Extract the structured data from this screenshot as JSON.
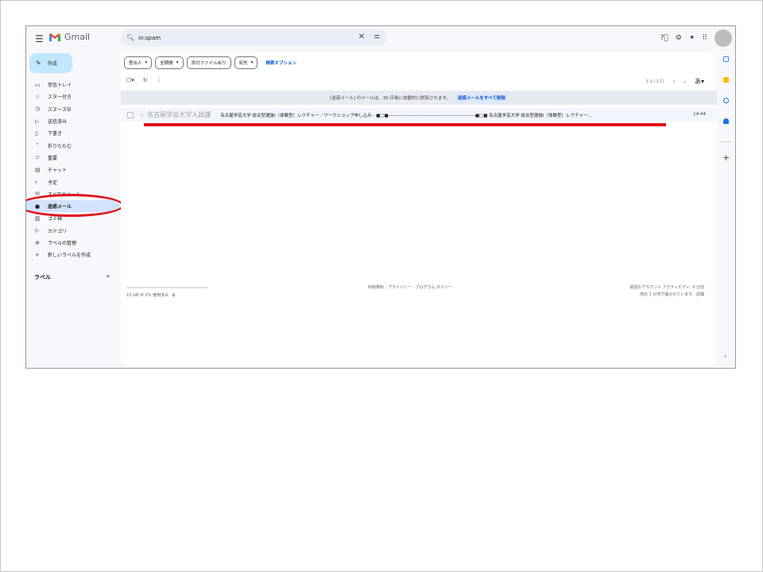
{
  "app": {
    "title": "Gmail"
  },
  "search": {
    "query": "in:spam"
  },
  "compose": {
    "label": "作成"
  },
  "nav": {
    "items": [
      {
        "icon": "inbox-icon",
        "glyph": "▭",
        "label": "受信トレイ"
      },
      {
        "icon": "star-icon",
        "glyph": "☆",
        "label": "スター付き"
      },
      {
        "icon": "clock-icon",
        "glyph": "◷",
        "label": "スヌーズ中"
      },
      {
        "icon": "send-icon",
        "glyph": "▷",
        "label": "送信済み"
      },
      {
        "icon": "draft-icon",
        "glyph": "▯",
        "label": "下書き"
      },
      {
        "icon": "collapse-icon",
        "glyph": "⌃",
        "label": "折りたたむ"
      },
      {
        "icon": "important-icon",
        "glyph": "⊃",
        "label": "重要"
      },
      {
        "icon": "chat-icon",
        "glyph": "▤",
        "label": "チャット"
      },
      {
        "icon": "scheduled-icon",
        "glyph": "▹",
        "label": "予定"
      },
      {
        "icon": "all-mail-icon",
        "glyph": "✉",
        "label": "すべてのメール"
      },
      {
        "icon": "spam-icon",
        "glyph": "●",
        "label": "迷惑メール"
      },
      {
        "icon": "trash-icon",
        "glyph": "▥",
        "label": "ゴミ箱"
      },
      {
        "icon": "category-icon",
        "glyph": "▷",
        "label": "カテゴリ"
      },
      {
        "icon": "manage-labels-icon",
        "glyph": "✲",
        "label": "ラベルの管理"
      },
      {
        "icon": "plus-icon",
        "glyph": "+",
        "label": "新しいラベルを作成"
      }
    ],
    "labels_heading": "ラベル",
    "labels_add": "+"
  },
  "filters": {
    "chips": [
      "差出人",
      "全期間",
      "添付ファイルあり",
      "宛先"
    ],
    "advanced": "検索オプション"
  },
  "pager": {
    "range": "1-1 / 1 行",
    "sort": "あ"
  },
  "banner": {
    "text": "[迷惑メール] のメールは、30 日後に自動的に削除されます。",
    "action": "迷惑メールをすべて削除"
  },
  "messages": [
    {
      "sender": "名古屋学芸大学入試課",
      "subject": "名古屋学芸大学 総合型選抜Ⅰ（体験型）レクチャー／ワークショップ申し込み - ■□■-------------------------------------------------------■□■ 名古屋学芸大学 総合型選抜Ⅰ（体験型）レクチャー...",
      "time": "14:44"
    }
  ],
  "footer": {
    "storage": "15 GB 中 0% 使用済み",
    "links": "利用規約 · プライバシー · プログラム ポリシー",
    "activity_1": "前回のアカウント アクティビティ: 0 分前",
    "activity_2": "他の 1 か所で開かれています · 詳細"
  },
  "colors": {
    "annotation": "#e0141d",
    "compose": "#c2e7ff",
    "active": "#d3e3fd",
    "link": "#0b57d0"
  }
}
